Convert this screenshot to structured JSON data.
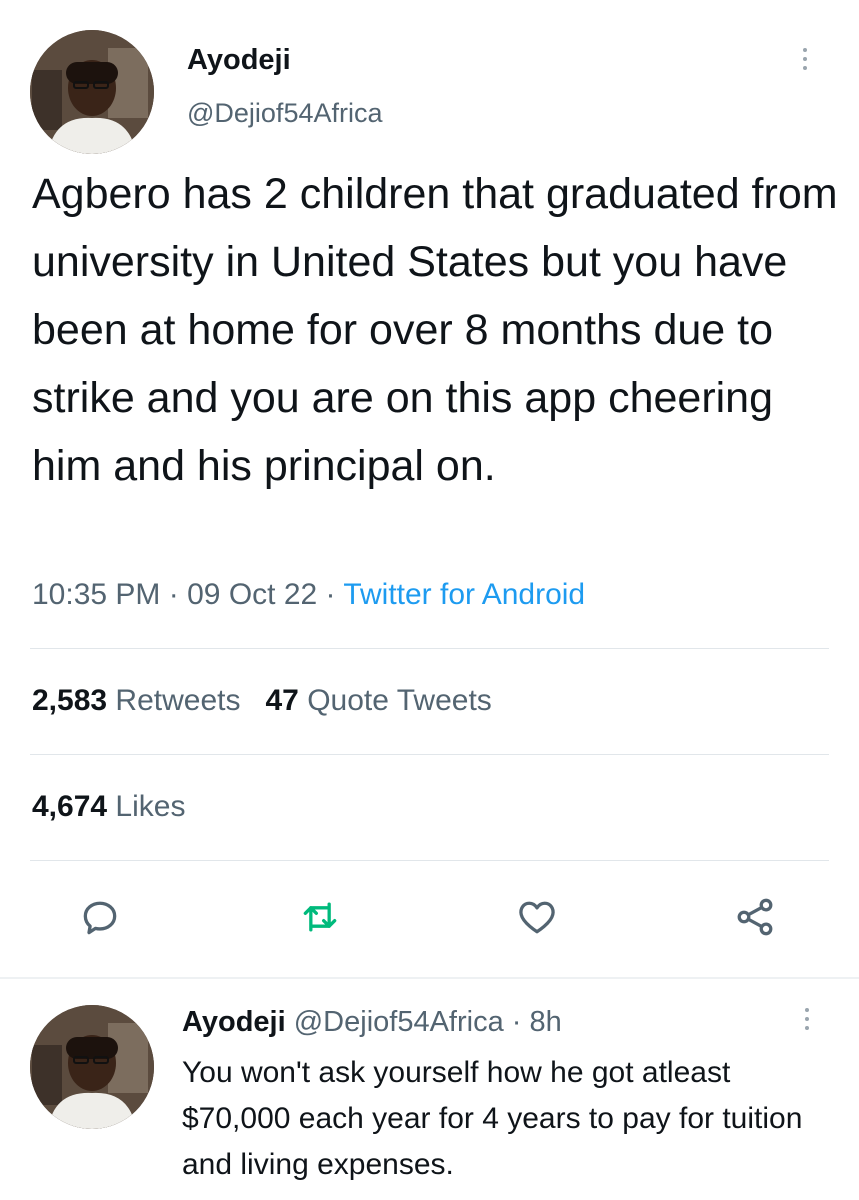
{
  "tweet": {
    "name": "Ayodeji",
    "handle": "@Dejiof54Africa",
    "text": "Agbero has 2 children that graduated from university in United States but you have been at home for over 8 months due to strike and you are on this app cheering him and his principal on.",
    "time": "10:35 PM",
    "date": "09 Oct 22",
    "separator": "·",
    "source": "Twitter for Android",
    "retweets_count": "2,583",
    "retweets_label": "Retweets",
    "quotes_count": "47",
    "quotes_label": "Quote Tweets",
    "likes_count": "4,674",
    "likes_label": "Likes"
  },
  "actions": {
    "reply_icon": "reply-icon",
    "retweet_icon": "retweet-icon",
    "like_icon": "heart-icon",
    "share_icon": "share-icon"
  },
  "reply": {
    "name": "Ayodeji",
    "handle": "@Dejiof54Africa",
    "separator": "·",
    "age": "8h",
    "text": "You won't ask yourself how he got atleast $70,000 each year for 4 years to pay for tuition and living expenses."
  },
  "colors": {
    "text": "#0f1419",
    "secondary": "#536471",
    "link": "#1d9bf0",
    "retweet_green": "#00ba7c",
    "divider": "#e1e6ea"
  }
}
